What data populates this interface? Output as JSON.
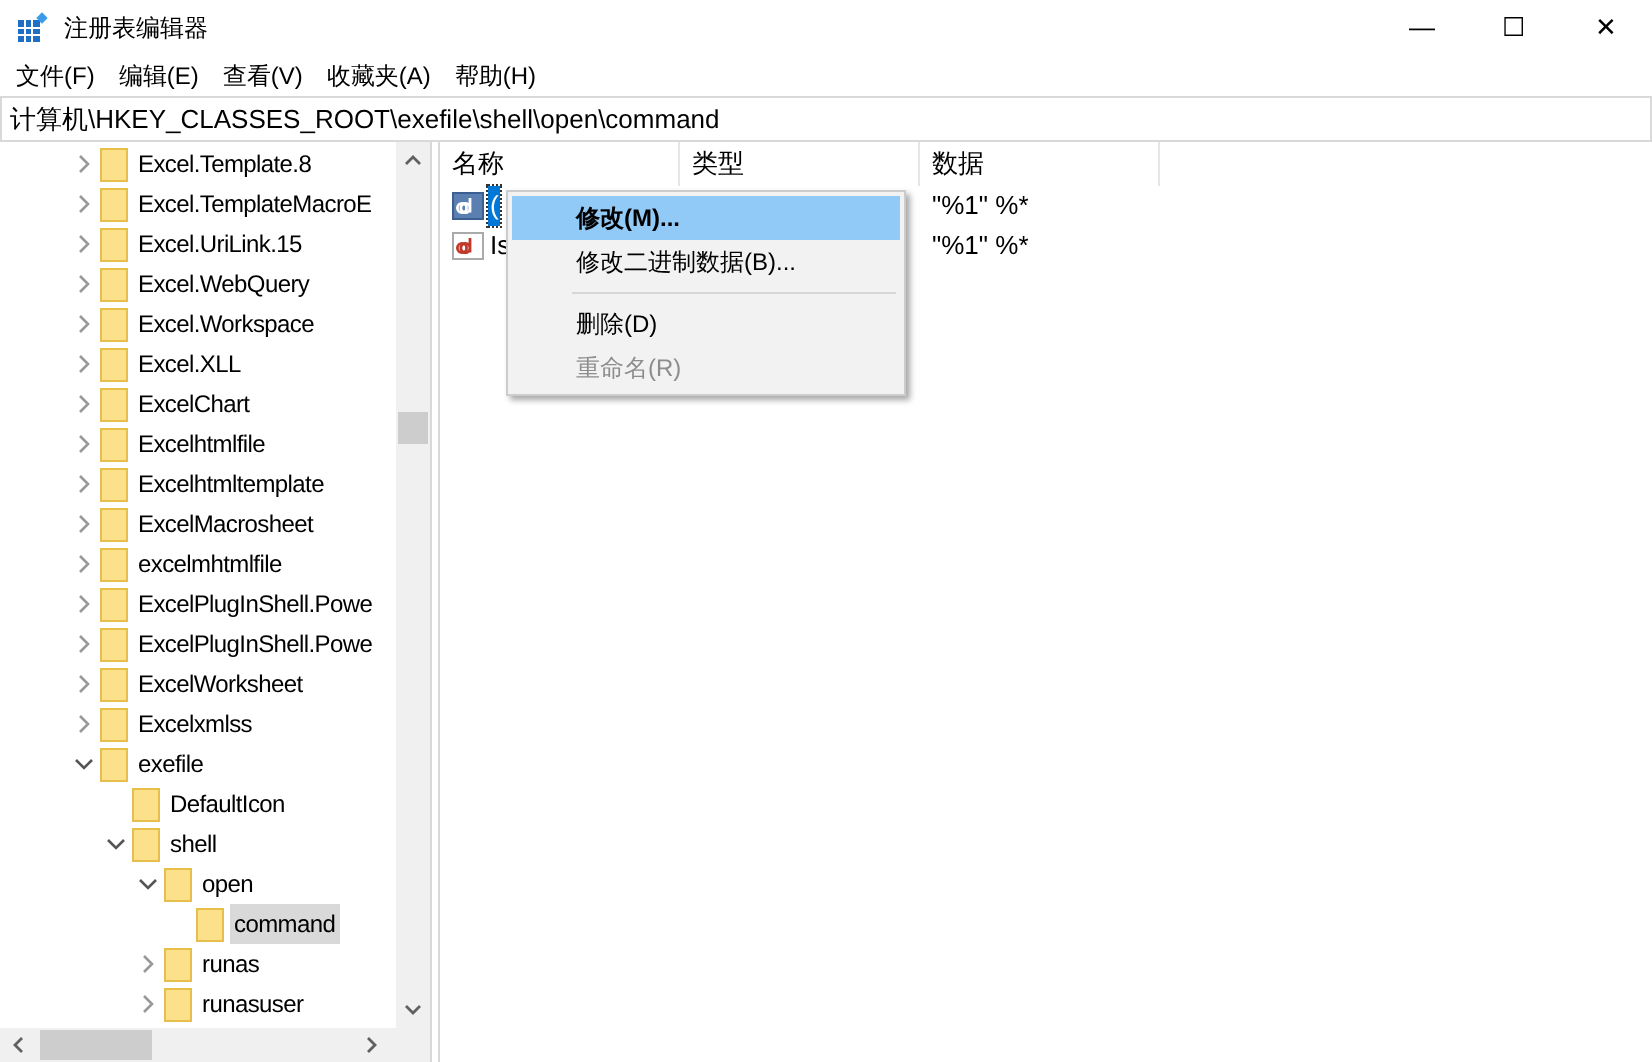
{
  "window": {
    "title": "注册表编辑器",
    "controls": [
      "—",
      "☐",
      "✕"
    ]
  },
  "menu": [
    "文件(F)",
    "编辑(E)",
    "查看(V)",
    "收藏夹(A)",
    "帮助(H)"
  ],
  "address": "计算机\\HKEY_CLASSES_ROOT\\exefile\\shell\\open\\command",
  "tree": [
    {
      "label": "Excel.Template.8",
      "expanded": false,
      "selected": false
    },
    {
      "label": "Excel.TemplateMacroE",
      "expanded": false,
      "selected": false
    },
    {
      "label": "Excel.UriLink.15",
      "expanded": false,
      "selected": false
    },
    {
      "label": "Excel.WebQuery",
      "expanded": false,
      "selected": false
    },
    {
      "label": "Excel.Workspace",
      "expanded": false,
      "selected": false
    },
    {
      "label": "Excel.XLL",
      "expanded": false,
      "selected": false
    },
    {
      "label": "ExcelChart",
      "expanded": false,
      "selected": false
    },
    {
      "label": "Excelhtmlfile",
      "expanded": false,
      "selected": false
    },
    {
      "label": "Excelhtmltemplate",
      "expanded": false,
      "selected": false
    },
    {
      "label": "ExcelMacrosheet",
      "expanded": false,
      "selected": false
    },
    {
      "label": "excelmhtmlfile",
      "expanded": false,
      "selected": false
    },
    {
      "label": "ExcelPlugInShell.Powe",
      "expanded": false,
      "selected": false
    },
    {
      "label": "ExcelPlugInShell.Powe",
      "expanded": false,
      "selected": false
    },
    {
      "label": "ExcelWorksheet",
      "expanded": false,
      "selected": false
    },
    {
      "label": "Excelxmlss",
      "expanded": false,
      "selected": false
    },
    {
      "label": "exefile",
      "expanded": true,
      "selected": false,
      "children": [
        {
          "label": "DefaultIcon",
          "selected": false
        },
        {
          "label": "shell",
          "expanded": true,
          "selected": false,
          "children": [
            {
              "label": "open",
              "expanded": true,
              "selected": false,
              "children": [
                {
                  "label": "command",
                  "selected": true
                }
              ]
            },
            {
              "label": "runas",
              "expanded": false,
              "selected": false
            },
            {
              "label": "runasuser",
              "expanded": false,
              "selected": false
            }
          ]
        }
      ]
    }
  ],
  "columns": [
    "名称",
    "类型",
    "数据"
  ],
  "values": [
    {
      "name": "(",
      "selected": true,
      "data": "\"%1\" %*"
    },
    {
      "name": "Is",
      "selected": false,
      "data": "\"%1\" %*"
    }
  ],
  "context_menu": [
    {
      "kind": "item",
      "label": "修改(M)...",
      "selected": true,
      "disabled": false
    },
    {
      "kind": "item",
      "label": "修改二进制数据(B)...",
      "selected": false,
      "disabled": false
    },
    {
      "kind": "separator"
    },
    {
      "kind": "item",
      "label": "删除(D)",
      "selected": false,
      "disabled": false
    },
    {
      "kind": "item",
      "label": "重命名(R)",
      "selected": false,
      "disabled": true
    }
  ]
}
